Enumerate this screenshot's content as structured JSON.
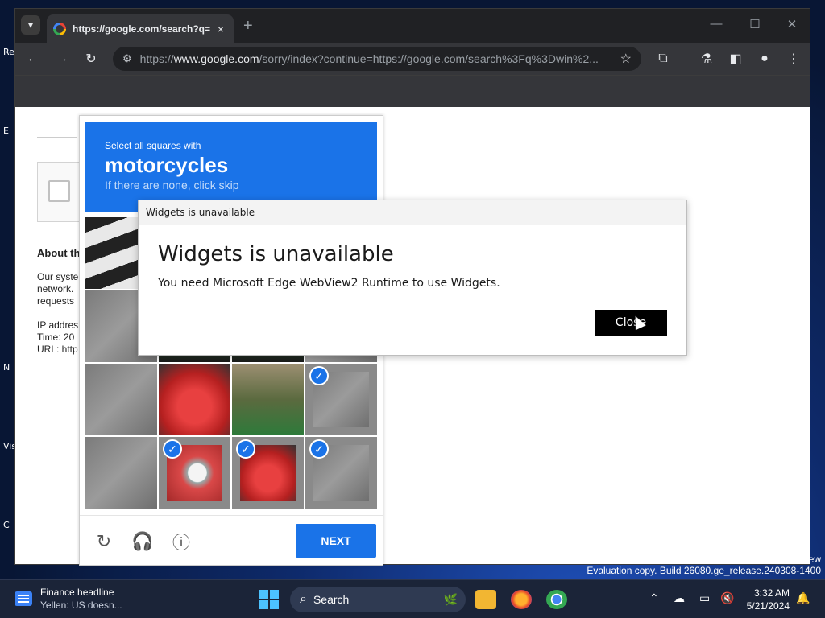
{
  "desktop": {
    "icon_labels": [
      "Re",
      "E",
      "N",
      "Vis",
      "C"
    ]
  },
  "browser": {
    "tab": {
      "title": "https://google.com/search?q=",
      "close": "×"
    },
    "new_tab": "+",
    "window_controls": {
      "minimize": "—",
      "maximize": "☐",
      "close": "✕"
    },
    "address": {
      "scheme": "https://",
      "host": "www.google.com",
      "path": "/sorry/index?continue=https://google.com/search%3Fq%3Dwin%2..."
    }
  },
  "page": {
    "about_title": "About th",
    "about_lines": [
      "Our syste",
      "network.",
      "requests",
      "",
      "IP addres",
      "Time: 20",
      "URL: http"
    ]
  },
  "captcha": {
    "instruction_line": "Select all squares with",
    "target": "motorcycles",
    "skip_hint": "If there are none, click skip",
    "next_label": "NEXT",
    "selected_tiles": [
      11,
      13,
      14,
      15
    ]
  },
  "dialog": {
    "title": "Widgets is unavailable",
    "heading": "Widgets is unavailable",
    "message": "You need Microsoft Edge WebView2 Runtime to use Widgets.",
    "close_label": "Close"
  },
  "watermark": {
    "line1": "ew",
    "line2": "Evaluation copy. Build 26080.ge_release.240308-1400"
  },
  "taskbar": {
    "news_title": "Finance headline",
    "news_subtitle": "Yellen: US doesn...",
    "search_label": "Search",
    "time": "3:32 AM",
    "date": "5/21/2024"
  },
  "colors": {
    "captcha_blue": "#1a73e8",
    "browser_dark": "#202124",
    "dialog_button": "#000000"
  }
}
